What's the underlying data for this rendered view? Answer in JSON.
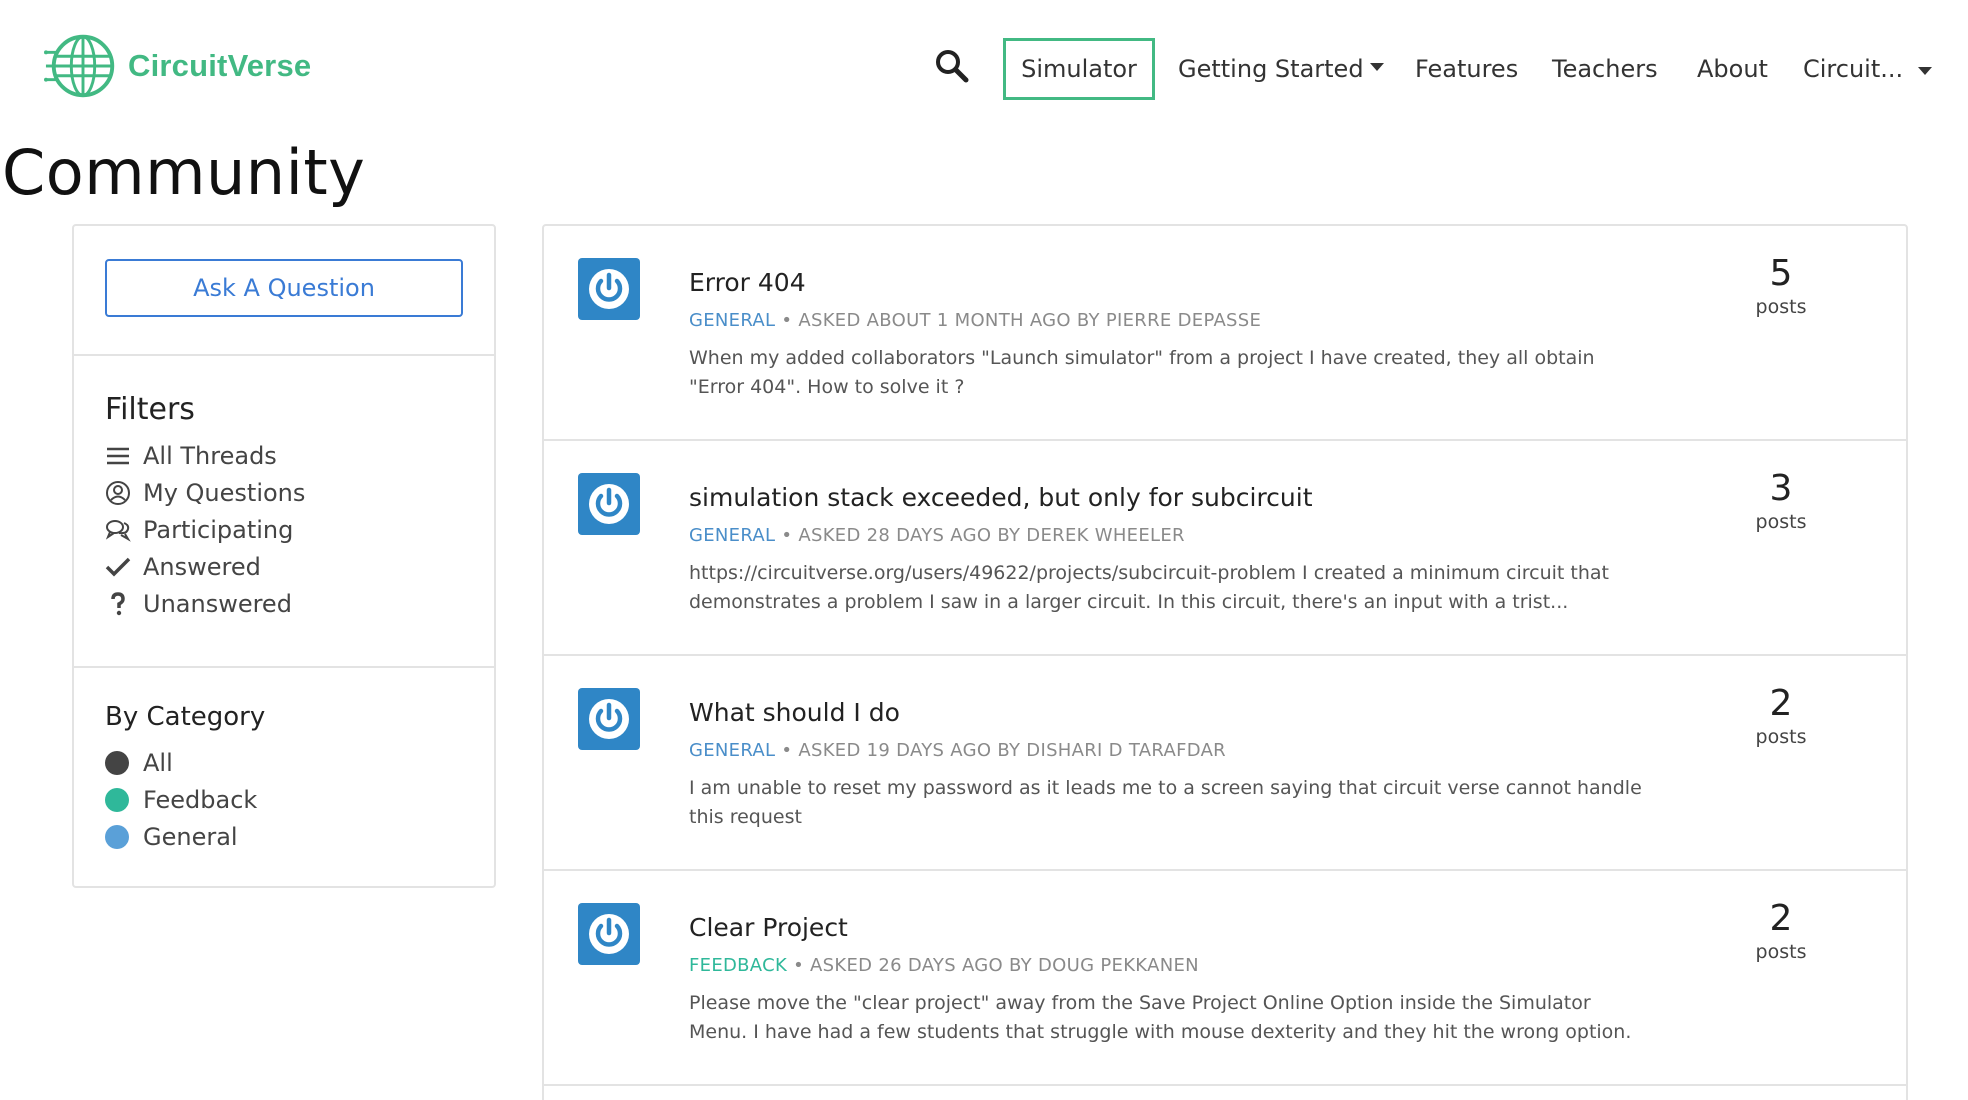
{
  "brand": {
    "name": "CircuitVerse",
    "color": "#42b983"
  },
  "nav": {
    "simulator": "Simulator",
    "getting_started": "Getting Started",
    "features": "Features",
    "teachers": "Teachers",
    "about": "About",
    "user": "Circuit..."
  },
  "page": {
    "title": "Community"
  },
  "sidebar": {
    "ask_button": "Ask A Question",
    "filters_title": "Filters",
    "filters": [
      {
        "label": "All Threads",
        "icon": "list-icon"
      },
      {
        "label": "My Questions",
        "icon": "user-circle-icon"
      },
      {
        "label": "Participating",
        "icon": "comments-icon"
      },
      {
        "label": "Answered",
        "icon": "check-icon"
      },
      {
        "label": "Unanswered",
        "icon": "question-icon"
      }
    ],
    "category_title": "By Category",
    "categories": [
      {
        "label": "All",
        "color": "#444444"
      },
      {
        "label": "Feedback",
        "color": "#2fb89a"
      },
      {
        "label": "General",
        "color": "#5aa0d8"
      }
    ]
  },
  "threads": [
    {
      "title": "Error 404",
      "category": "GENERAL",
      "meta": "ASKED ABOUT 1 MONTH AGO BY PIERRE DEPASSE",
      "excerpt": "When my added collaborators \"Launch simulator\" from a project I have created, they all obtain \"Error 404\". How to solve it ?",
      "count": "5",
      "count_label": "posts"
    },
    {
      "title": "simulation stack exceeded, but only for subcircuit",
      "category": "GENERAL",
      "meta": "ASKED 28 DAYS AGO BY DEREK WHEELER",
      "excerpt": "https://circuitverse.org/users/49622/projects/subcircuit-problem I created a minimum circuit that demonstrates a problem I saw in a larger circuit. In this circuit, there's an input with a trist...",
      "count": "3",
      "count_label": "posts"
    },
    {
      "title": "What should I do",
      "category": "GENERAL",
      "meta": "ASKED 19 DAYS AGO BY DISHARI D TARAFDAR",
      "excerpt": "I am unable to reset my password as it leads me to a screen saying that circuit verse cannot handle this request",
      "count": "2",
      "count_label": "posts"
    },
    {
      "title": "Clear Project",
      "category": "FEEDBACK",
      "meta": "ASKED 26 DAYS AGO BY DOUG PEKKANEN",
      "excerpt": "Please move the \"clear project\" away from the Save Project Online Option inside the Simulator Menu. I have had a few students that struggle with mouse dexterity and they hit the wrong option.",
      "count": "2",
      "count_label": "posts"
    }
  ]
}
